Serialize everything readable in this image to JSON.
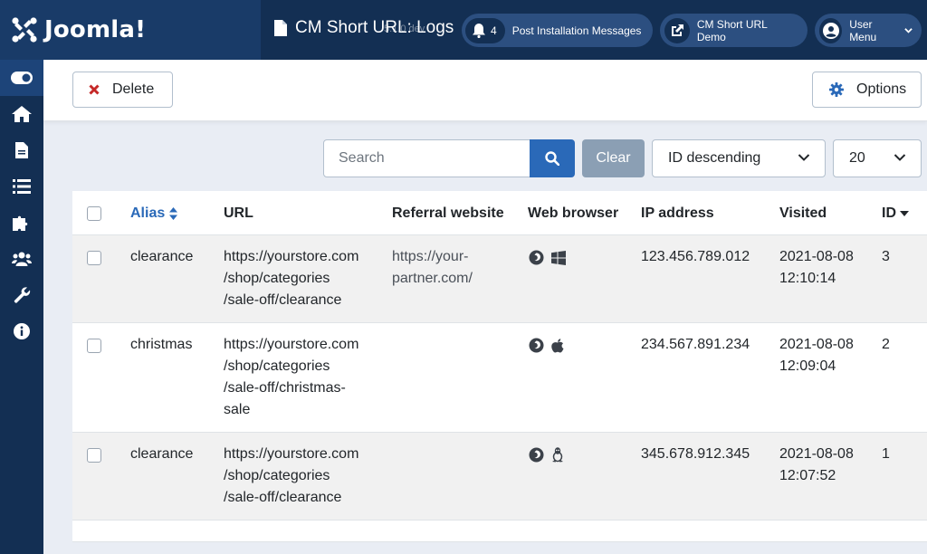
{
  "header": {
    "brand": "Joomla!",
    "title": "CM Short URL: Logs",
    "version_ghost": "5.1.0 dev",
    "notifications_count": "4",
    "post_install_label": "Post Installation Messages",
    "site_link_label": "CM Short URL Demo",
    "user_menu_label": "User Menu"
  },
  "sidebar": {
    "items": [
      {
        "icon": "toggle-menu-icon",
        "active": true
      },
      {
        "icon": "home-icon"
      },
      {
        "icon": "file-icon"
      },
      {
        "icon": "list-icon"
      },
      {
        "icon": "puzzle-icon"
      },
      {
        "icon": "users-icon"
      },
      {
        "icon": "wrench-icon"
      },
      {
        "icon": "info-icon"
      }
    ]
  },
  "toolbar": {
    "delete_label": "Delete",
    "options_label": "Options"
  },
  "filters": {
    "search_placeholder": "Search",
    "clear_label": "Clear",
    "ordering_value": "ID descending",
    "limit_value": "20"
  },
  "table": {
    "columns": {
      "alias": "Alias",
      "url": "URL",
      "referral": "Referral website",
      "browser": "Web browser",
      "ip": "IP address",
      "visited": "Visited",
      "id": "ID"
    },
    "rows": [
      {
        "alias": "clearance",
        "url_lines": [
          "https://yourstore.com",
          "/shop/categories",
          "/sale-off/clearance"
        ],
        "referral_lines": [
          "https://your-",
          "partner.com/"
        ],
        "browser_icons": [
          "firefox-icon",
          "windows-icon"
        ],
        "ip": "123.456.789.012",
        "visited_date": "2021-08-08",
        "visited_time": "12:10:14",
        "id": "3"
      },
      {
        "alias": "christmas",
        "url_lines": [
          "https://yourstore.com",
          "/shop/categories",
          "/sale-off/christmas-",
          "sale"
        ],
        "referral_lines": [],
        "browser_icons": [
          "firefox-icon",
          "apple-icon"
        ],
        "ip": "234.567.891.234",
        "visited_date": "2021-08-08",
        "visited_time": "12:09:04",
        "id": "2"
      },
      {
        "alias": "clearance",
        "url_lines": [
          "https://yourstore.com",
          "/shop/categories",
          "/sale-off/clearance"
        ],
        "referral_lines": [],
        "browser_icons": [
          "firefox-icon",
          "linux-icon"
        ],
        "ip": "345.678.912.345",
        "visited_date": "2021-08-08",
        "visited_time": "12:07:52",
        "id": "1"
      }
    ]
  },
  "colors": {
    "header_bg": "#132f53",
    "brand_bg": "#193b68",
    "accent": "#2a69b8",
    "delete_red": "#c52827",
    "clear_btn": "#8b9fb4"
  }
}
